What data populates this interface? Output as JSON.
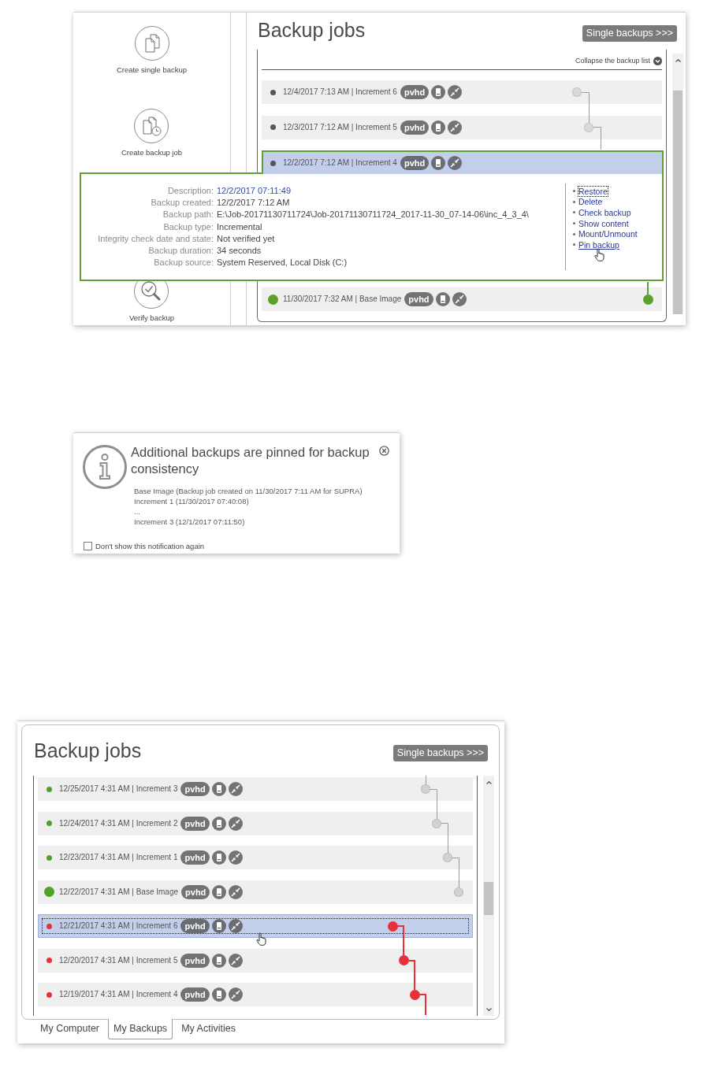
{
  "backup_window_top": {
    "sidebar": {
      "items": [
        {
          "label": "Create single backup"
        },
        {
          "label": "Create backup job"
        },
        {
          "label": "Verify backup"
        }
      ]
    },
    "title": "Backup jobs",
    "switch_button": "Single backups >>>",
    "collapse_link": "Collapse the backup list",
    "rows": [
      {
        "kind": "increment",
        "label": "12/4/2017 7:13 AM | Increment 6",
        "badge": "pvhd",
        "color": "#555555",
        "chain_highlighted": false,
        "selected": false,
        "expanded": false
      },
      {
        "kind": "increment",
        "label": "12/3/2017 7:12 AM | Increment 5",
        "badge": "pvhd",
        "color": "#555555",
        "chain_highlighted": false,
        "selected": false,
        "expanded": false
      },
      {
        "kind": "increment",
        "label": "12/2/2017 7:12 AM | Increment 4",
        "badge": "pvhd",
        "color": "#555555",
        "selected": true,
        "expanded": true,
        "details": {
          "fields": [
            {
              "label": "Description:",
              "value": "12/2/2017 07:11:49",
              "kind": "link"
            },
            {
              "label": "Backup created:",
              "value": "12/2/2017 7:12 AM",
              "kind": "text"
            },
            {
              "label": "Backup path:",
              "value": "E:\\Job-20171130711724\\Job-20171130711724_2017-11-30_07-14-06\\inc_4_3_4\\",
              "kind": "text"
            },
            {
              "label": "Backup type:",
              "value": "Incremental",
              "kind": "text"
            },
            {
              "label": "Integrity check date and state:",
              "value": "Not verified yet",
              "kind": "text"
            },
            {
              "label": "Backup duration:",
              "value": "34 seconds",
              "kind": "text"
            },
            {
              "label": "Backup source:",
              "value": "System Reserved, Local Disk (C:)",
              "kind": "text"
            }
          ],
          "actions": [
            {
              "label": "Restore",
              "focused": true,
              "hovered": false
            },
            {
              "label": "Delete",
              "focused": false,
              "hovered": false
            },
            {
              "label": "Check backup",
              "focused": false,
              "hovered": false
            },
            {
              "label": "Show content",
              "focused": false,
              "hovered": false
            },
            {
              "label": "Mount/Unmount",
              "focused": false,
              "hovered": false
            },
            {
              "label": "Pin backup",
              "focused": false,
              "hovered": true
            }
          ]
        }
      },
      {
        "kind": "base",
        "label": "11/30/2017 7:32 AM | Base Image",
        "badge": "pvhd",
        "color": "#5aa02c",
        "chain_highlighted": true,
        "selected": false,
        "expanded": false
      }
    ]
  },
  "notification": {
    "title": "Additional backups are pinned for backup consistency",
    "lines": [
      "Base Image (Backup job created on 11/30/2017 7:11 AM for SUPRA)",
      "Increment 1 (11/30/2017 07:40:08)",
      "...",
      "Increment 3 (12/1/2017 07:11:50)"
    ],
    "checkbox": {
      "label": "Don't show this notification again",
      "checked": false
    }
  },
  "backup_window_bottom": {
    "title": "Backup jobs",
    "switch_button": "Single backups >>>",
    "rows": [
      {
        "kind": "increment",
        "label": "12/25/2017 4:31 AM | Increment 3",
        "badge": "pvhd",
        "color": "#4fa12a",
        "chain_highlighted": false,
        "selected": false,
        "focused": false,
        "hovered": false
      },
      {
        "kind": "increment",
        "label": "12/24/2017 4:31 AM | Increment 2",
        "badge": "pvhd",
        "color": "#4fa12a",
        "chain_highlighted": false,
        "selected": false,
        "focused": false,
        "hovered": false
      },
      {
        "kind": "increment",
        "label": "12/23/2017 4:31 AM | Increment 1",
        "badge": "pvhd",
        "color": "#4fa12a",
        "chain_highlighted": false,
        "selected": false,
        "focused": false,
        "hovered": false
      },
      {
        "kind": "base",
        "label": "12/22/2017 4:31 AM | Base Image",
        "badge": "pvhd",
        "color": "#4fa12a",
        "chain_highlighted": false,
        "selected": false,
        "focused": false,
        "hovered": false
      },
      {
        "kind": "increment",
        "label": "12/21/2017 4:31 AM | Increment 6",
        "badge": "pvhd",
        "color": "#e8303a",
        "chain_highlighted": true,
        "selected": true,
        "focused": true,
        "hovered": true
      },
      {
        "kind": "increment",
        "label": "12/20/2017 4:31 AM | Increment 5",
        "badge": "pvhd",
        "color": "#e8303a",
        "chain_highlighted": true,
        "selected": false,
        "focused": false,
        "hovered": false
      },
      {
        "kind": "increment",
        "label": "12/19/2017 4:31 AM | Increment 4",
        "badge": "pvhd",
        "color": "#e8303a",
        "chain_highlighted": true,
        "selected": false,
        "focused": false,
        "hovered": false
      }
    ],
    "tabs": [
      {
        "label": "My Computer",
        "selected": false
      },
      {
        "label": "My Backups",
        "selected": true
      },
      {
        "label": "My Activities",
        "selected": false
      }
    ]
  }
}
